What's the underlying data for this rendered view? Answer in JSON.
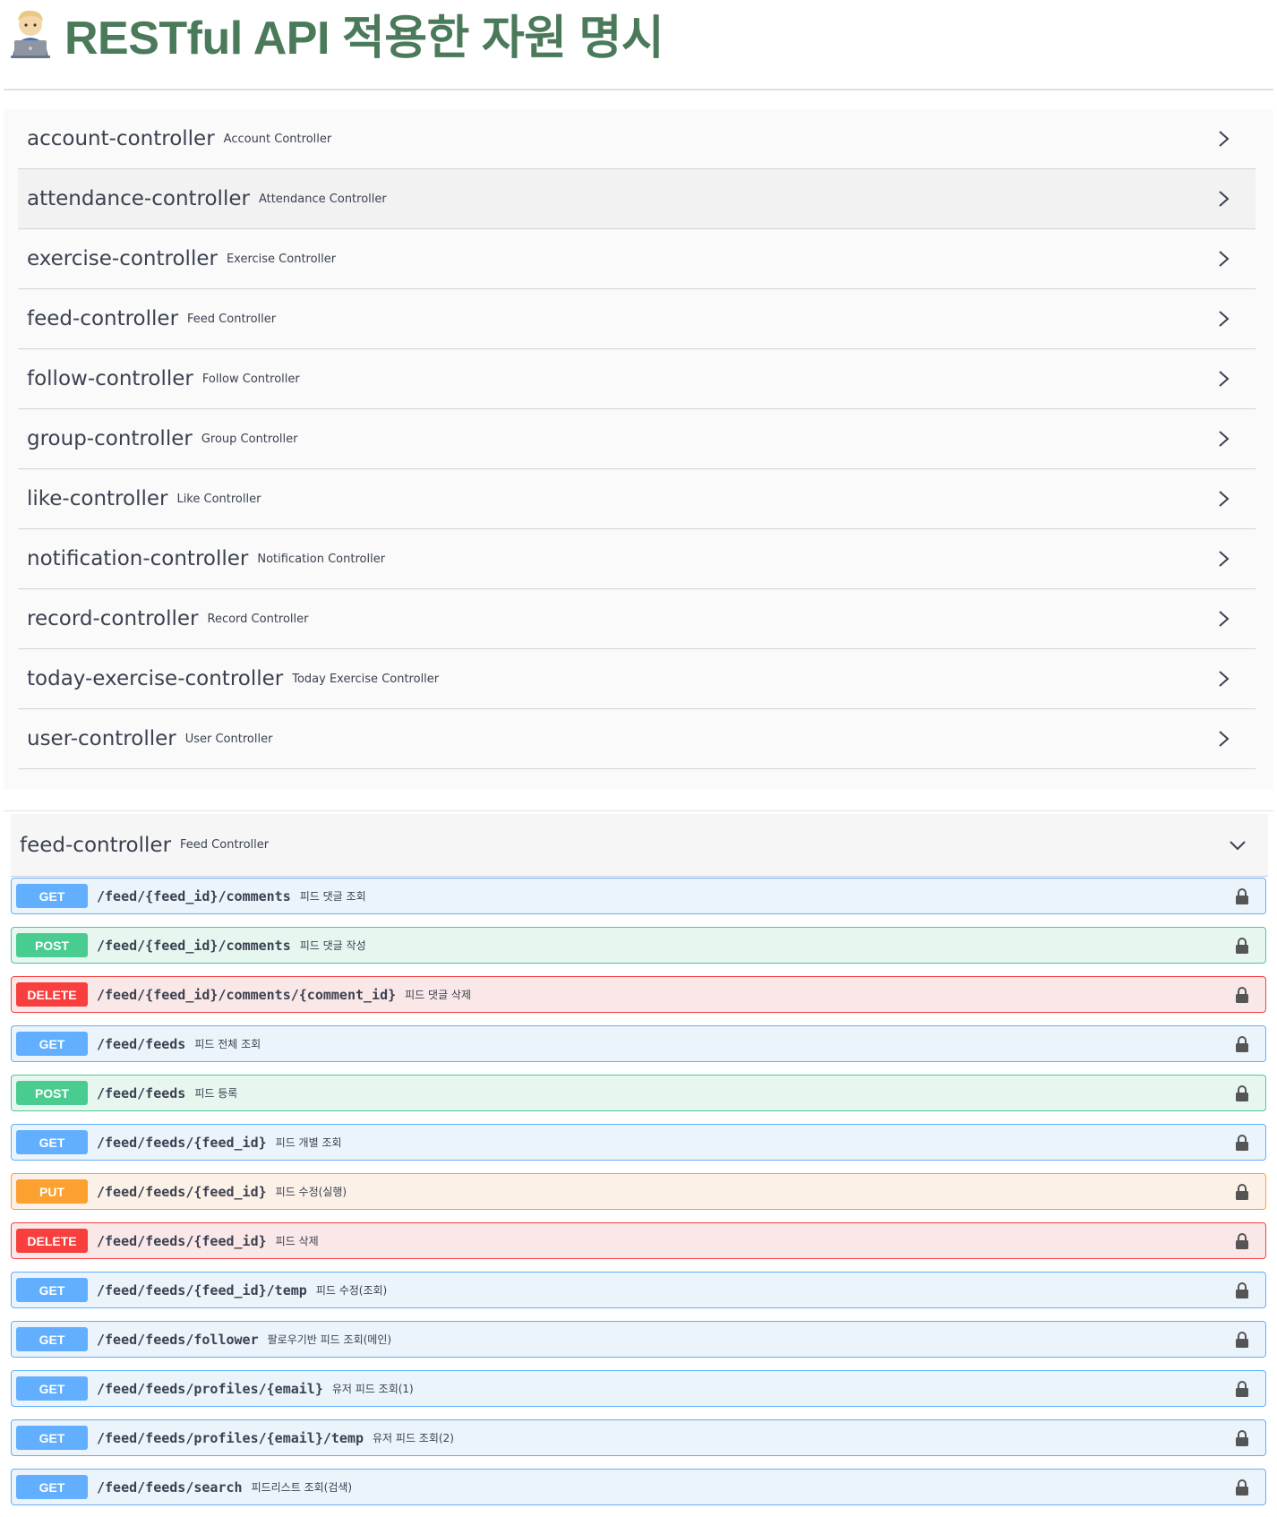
{
  "title": {
    "emoji": "technologist-emoji",
    "text": "RESTful API 적용한 자원 명시"
  },
  "tags": [
    {
      "name": "account-controller",
      "description": "Account Controller"
    },
    {
      "name": "attendance-controller",
      "description": "Attendance Controller"
    },
    {
      "name": "exercise-controller",
      "description": "Exercise Controller"
    },
    {
      "name": "feed-controller",
      "description": "Feed Controller"
    },
    {
      "name": "follow-controller",
      "description": "Follow Controller"
    },
    {
      "name": "group-controller",
      "description": "Group Controller"
    },
    {
      "name": "like-controller",
      "description": "Like Controller"
    },
    {
      "name": "notification-controller",
      "description": "Notification Controller"
    },
    {
      "name": "record-controller",
      "description": "Record Controller"
    },
    {
      "name": "today-exercise-controller",
      "description": "Today Exercise Controller"
    },
    {
      "name": "user-controller",
      "description": "User Controller"
    }
  ],
  "feed_section": {
    "name": "feed-controller",
    "description": "Feed Controller",
    "operations": [
      {
        "method": "GET",
        "path": "/feed/{feed_id}/comments",
        "summary": "피드 댓글 조회"
      },
      {
        "method": "POST",
        "path": "/feed/{feed_id}/comments",
        "summary": "피드 댓글 작성"
      },
      {
        "method": "DELETE",
        "path": "/feed/{feed_id}/comments/{comment_id}",
        "summary": "피드 댓글 삭제"
      },
      {
        "method": "GET",
        "path": "/feed/feeds",
        "summary": "피드 전체 조회"
      },
      {
        "method": "POST",
        "path": "/feed/feeds",
        "summary": "피드 등록"
      },
      {
        "method": "GET",
        "path": "/feed/feeds/{feed_id}",
        "summary": "피드 개별 조회"
      },
      {
        "method": "PUT",
        "path": "/feed/feeds/{feed_id}",
        "summary": "피드 수정(실행)"
      },
      {
        "method": "DELETE",
        "path": "/feed/feeds/{feed_id}",
        "summary": "피드 삭제"
      },
      {
        "method": "GET",
        "path": "/feed/feeds/{feed_id}/temp",
        "summary": "피드 수정(조회)"
      },
      {
        "method": "GET",
        "path": "/feed/feeds/follower",
        "summary": "팔로우기반 피드 조회(메인)"
      },
      {
        "method": "GET",
        "path": "/feed/feeds/profiles/{email}",
        "summary": "유저 피드 조회(1)"
      },
      {
        "method": "GET",
        "path": "/feed/feeds/profiles/{email}/temp",
        "summary": "유저 피드 조회(2)"
      },
      {
        "method": "GET",
        "path": "/feed/feeds/search",
        "summary": "피드리스트 조회(검색)"
      }
    ]
  },
  "colors": {
    "title": "#4a7a5a",
    "get": "#61affe",
    "post": "#49cc90",
    "delete": "#f93e3e",
    "put": "#fca130"
  },
  "icons": {
    "collapsed": "chevron-right-icon",
    "expanded": "chevron-down-icon",
    "auth": "lock-icon"
  }
}
